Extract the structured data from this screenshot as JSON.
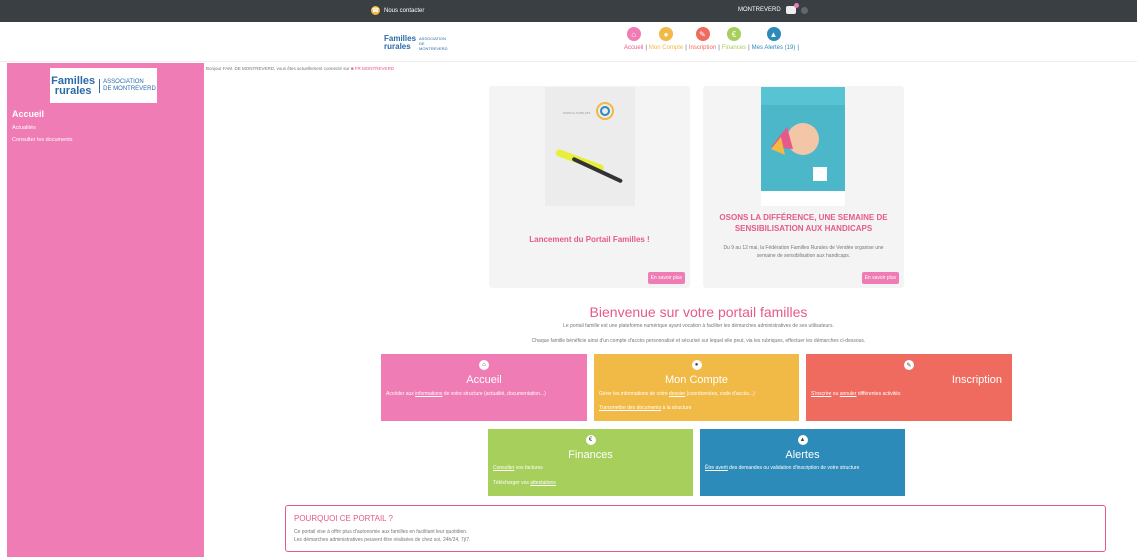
{
  "topbar": {
    "contact_label": "Nous contacter",
    "user_label": "MONTREVERD"
  },
  "header": {
    "nav": [
      {
        "label": "Accueil",
        "color": "#ef7cb4",
        "glyph": "⌂"
      },
      {
        "label": "Mon Compte",
        "color": "#f1b946",
        "glyph": "●"
      },
      {
        "label": "Inscription",
        "color": "#ef6a5f",
        "glyph": "✎"
      },
      {
        "label": "Finances",
        "color": "#a7cf5b",
        "glyph": "€"
      },
      {
        "label": "Mes Alertes (19)",
        "color": "#2c8bb8",
        "glyph": "▲"
      }
    ]
  },
  "sidebar": {
    "logo_line1": "Familles",
    "logo_line2": "rurales",
    "logo_assoc": "ASSOCIATION",
    "logo_place": "DE MONTREVERD",
    "title": "Accueil",
    "links": [
      "Actualités",
      "Consulter les documents"
    ]
  },
  "welcome": {
    "text": "Bonjour FAM. DE MONTREVERD, vous êtes actuellement connecté sur",
    "structure": "FR MONTREVERD"
  },
  "cards": [
    {
      "title": "Lancement du Portail Familles !",
      "text": "",
      "more": "En savoir plus"
    },
    {
      "title": "OSONS LA DIFFÉRENCE, UNE SEMAINE DE SENSIBILISATION AUX HANDICAPS",
      "text": "Du 9 au 12 mai, la Fédération Familles Rurales de Vendée organise une semaine de sensibilisation aux handicaps.",
      "more": "En savoir plus"
    }
  ],
  "main": {
    "title": "Bienvenue sur votre portail familles",
    "intro1": "Le portail famille est une plateforme numérique ayant vocation à faciliter les démarches administratives de ses utilisateurs.",
    "intro2": "Chaque famille bénéficie ainsi d'un compte d'accès personnalisé et sécurisé sur lequel elle peut, via les rubriques, effectuer les démarches ci-dessous."
  },
  "tiles": {
    "accueil": {
      "title": "Accueil",
      "pre": "Accéder aux ",
      "link": "informations",
      "post": " de votre structure (actualité, documentation...)"
    },
    "compte": {
      "title": "Mon Compte",
      "pre": "Gérer les informations de votre ",
      "link": "dossier",
      "post": " (coordonnées, code d'accès...)",
      "line2_link": "Transmettre des documents",
      "line2_post": " à la structure"
    },
    "inscription": {
      "title": "Inscription",
      "link1": "S'inscrire",
      "mid": " ou ",
      "link2": "annuler",
      "post": " différentes activités"
    },
    "finances": {
      "title": "Finances",
      "link1": "Consulter",
      "post1": " vos factures",
      "pre2": "Télécharger vos ",
      "link2": "attestations"
    },
    "alertes": {
      "title": "Alertes",
      "link": "Être averti",
      "post": " des demandes ou validation d'inscription de votre structure"
    }
  },
  "why": {
    "title": "POURQUOI CE PORTAIL ?",
    "line1": "Ce portail vise à offrir plus d'autonomie aux familles en facilitant leur quotidien.",
    "line2": "Les démarches administratives peuvent être réalisées de chez soi, 24h/24, 7j/7."
  }
}
